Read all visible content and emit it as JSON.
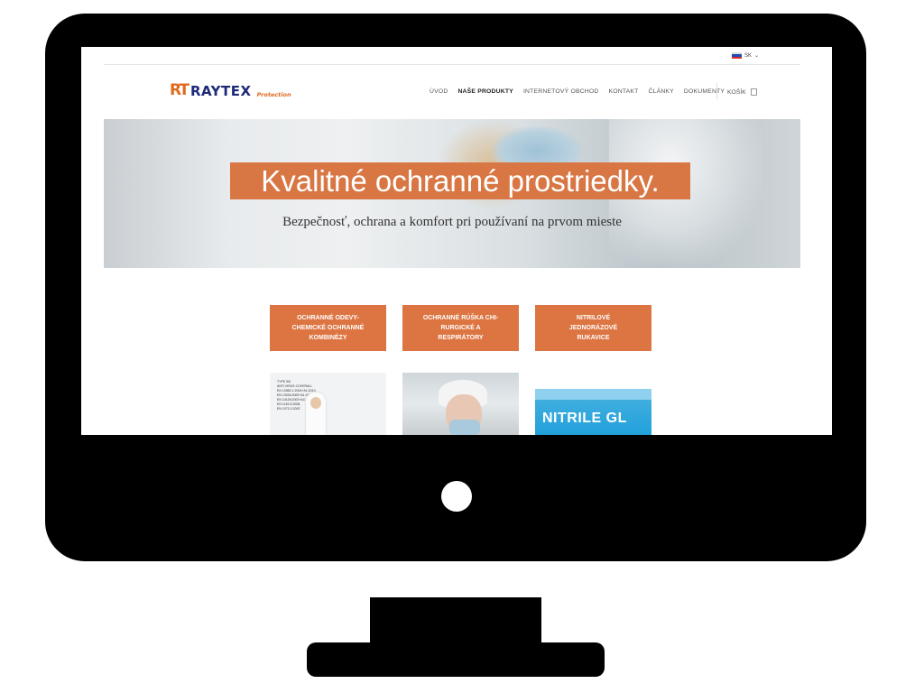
{
  "topbar": {
    "language": "SK"
  },
  "logo": {
    "mark": "RT",
    "name": "RAYTEX",
    "tagline": "Protection"
  },
  "nav": {
    "items": [
      {
        "label": "ÚVOD"
      },
      {
        "label": "NAŠE PRODUKTY"
      },
      {
        "label": "INTERNETOVÝ OBCHOD"
      },
      {
        "label": "KONTAKT"
      },
      {
        "label": "ČLÁNKY"
      },
      {
        "label": "DOKUMENTY"
      }
    ],
    "active": "NAŠE PRODUKTY",
    "cart_label": "KOŠÍK"
  },
  "hero": {
    "title": "Kvalitné ochranné prostriedky.",
    "subtitle": "Bezpečnosť, ochrana a komfort pri používaní na prvom mieste"
  },
  "categories": [
    {
      "label": "OCHRANNÉ ODEVY-\nCHEMICKÉ OCHRANNÉ\nKOMBINÉZY"
    },
    {
      "label": "OCHRANNÉ RÚŠKA CHI-\nRURGICKÉ A\nRESPIRÁTORY"
    },
    {
      "label": "NITRILOVÉ\nJEDNORÁZOVÉ\nRUKAVICE"
    }
  ],
  "thumbs": {
    "suit_text": "TYPE 5/6\nANTI VIRUS COVERALL\nEN 13982-1:2004+A1:2010,\nEN 13034:2005+A1:2009,\nEN 14126:2003+AC:2004,\nEN 1149-5:2008,\nEN 1073-2:2002",
    "box_label": "NITRILE GL"
  },
  "colors": {
    "accent": "#dd7543",
    "brand_blue": "#1d2a78",
    "brand_orange": "#e06b1f"
  }
}
